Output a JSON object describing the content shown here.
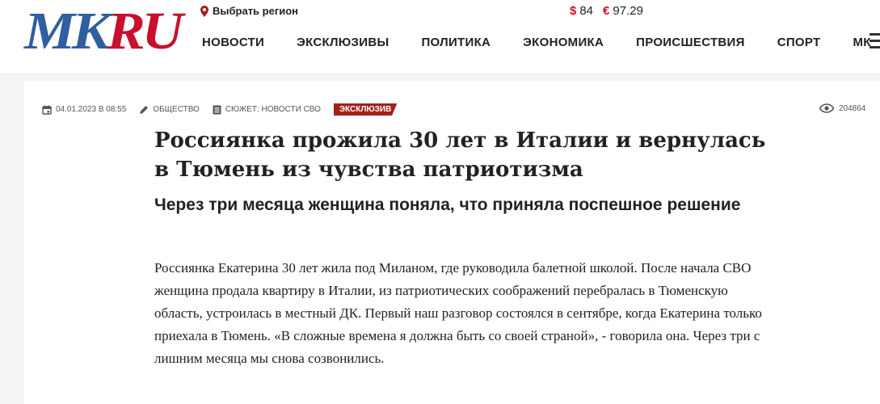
{
  "header": {
    "logo_mk": "MK",
    "logo_ru": "RU",
    "region_label": "Выбрать регион",
    "currency": {
      "usd_symbol": "$",
      "usd_value": "84",
      "eur_symbol": "€",
      "eur_value": "97.29"
    },
    "nav": [
      "НОВОСТИ",
      "ЭКСКЛЮЗИВЫ",
      "ПОЛИТИКА",
      "ЭКОНОМИКА",
      "ПРОИСШЕСТВИЯ",
      "СПОРТ",
      "МК"
    ]
  },
  "article": {
    "date": "04.01.2023 в 08:55",
    "rubric": "ОБЩЕСТВО",
    "story": "СЮЖЕТ: НОВОСТИ СВО",
    "badge": "ЭКСКЛЮЗИВ",
    "views": "204864",
    "title": "Россиянка прожила 30 лет в Италии и вернулась в Тюмень из чувства патриотизма",
    "subtitle": "Через три месяца женщина поняла, что приняла поспешное решение",
    "lead": "Россиянка Екатерина 30 лет жила под Миланом, где руководила балетной школой. После начала СВО женщина продала квартиру в Италии, из патриотических соображений перебралась в Тюменскую область, устроилась в местный ДК. Первый наш разговор состоялся в сентябре, когда Екатерина только приехала в Тюмень. «В сложные времена я должна быть со своей страной», - говорила она. Через три с лишним месяца мы снова созвонились."
  },
  "colors": {
    "brand_blue": "#2f5fa0",
    "brand_red": "#c8102e",
    "badge_red": "#a5211a"
  },
  "icons": [
    "pin-icon",
    "calendar-icon",
    "pencil-icon",
    "document-icon",
    "eye-icon",
    "hamburger-icon"
  ]
}
